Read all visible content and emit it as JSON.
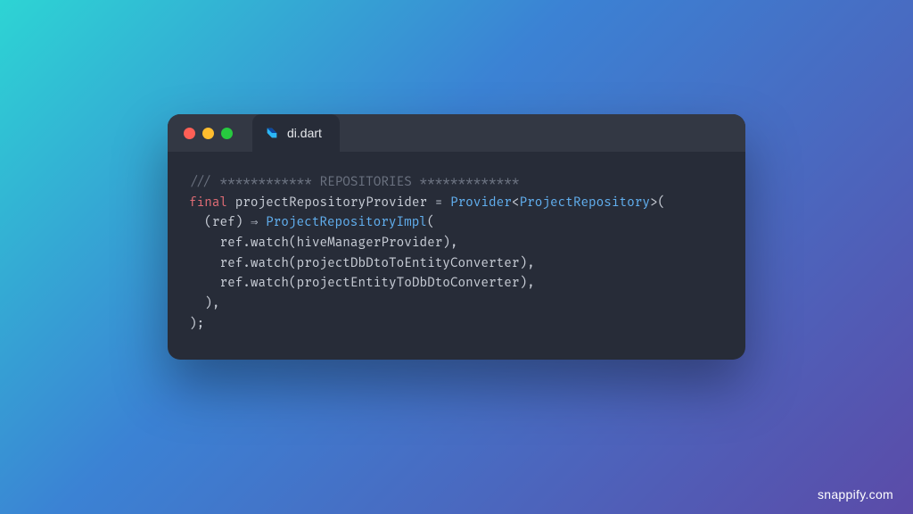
{
  "tab": {
    "filename": "di.dart",
    "icon": "dart-icon"
  },
  "colors": {
    "bg_gradient_start": "#2dd4d4",
    "bg_gradient_mid": "#3b82d4",
    "bg_gradient_end": "#5b4ba8",
    "editor_bg": "#272c38",
    "titlebar_bg": "#333844",
    "comment": "#6b7280",
    "keyword": "#e06c75",
    "class": "#61afef",
    "text": "#c8cdd6"
  },
  "code": {
    "lines": [
      [
        {
          "t": "/// ************ REPOSITORIES *************",
          "cls": "c-comment"
        }
      ],
      [
        {
          "t": "final",
          "cls": "c-keyword"
        },
        {
          "t": " projectRepositoryProvider ",
          "cls": "c-ident"
        },
        {
          "t": "=",
          "cls": "c-op"
        },
        {
          "t": " ",
          "cls": "c-ident"
        },
        {
          "t": "Provider",
          "cls": "c-class"
        },
        {
          "t": "<",
          "cls": "c-punct"
        },
        {
          "t": "ProjectRepository",
          "cls": "c-class"
        },
        {
          "t": ">(",
          "cls": "c-punct"
        }
      ],
      [
        {
          "t": "  (ref) ",
          "cls": "c-ident"
        },
        {
          "t": "⇒",
          "cls": "c-op"
        },
        {
          "t": " ",
          "cls": "c-ident"
        },
        {
          "t": "ProjectRepositoryImpl",
          "cls": "c-class"
        },
        {
          "t": "(",
          "cls": "c-punct"
        }
      ],
      [
        {
          "t": "    ref.watch(hiveManagerProvider),",
          "cls": "c-ident"
        }
      ],
      [
        {
          "t": "    ref.watch(projectDbDtoToEntityConverter),",
          "cls": "c-ident"
        }
      ],
      [
        {
          "t": "    ref.watch(projectEntityToDbDtoConverter),",
          "cls": "c-ident"
        }
      ],
      [
        {
          "t": "  ),",
          "cls": "c-punct"
        }
      ],
      [
        {
          "t": ");",
          "cls": "c-punct"
        }
      ]
    ]
  },
  "attribution": "snappify.com"
}
